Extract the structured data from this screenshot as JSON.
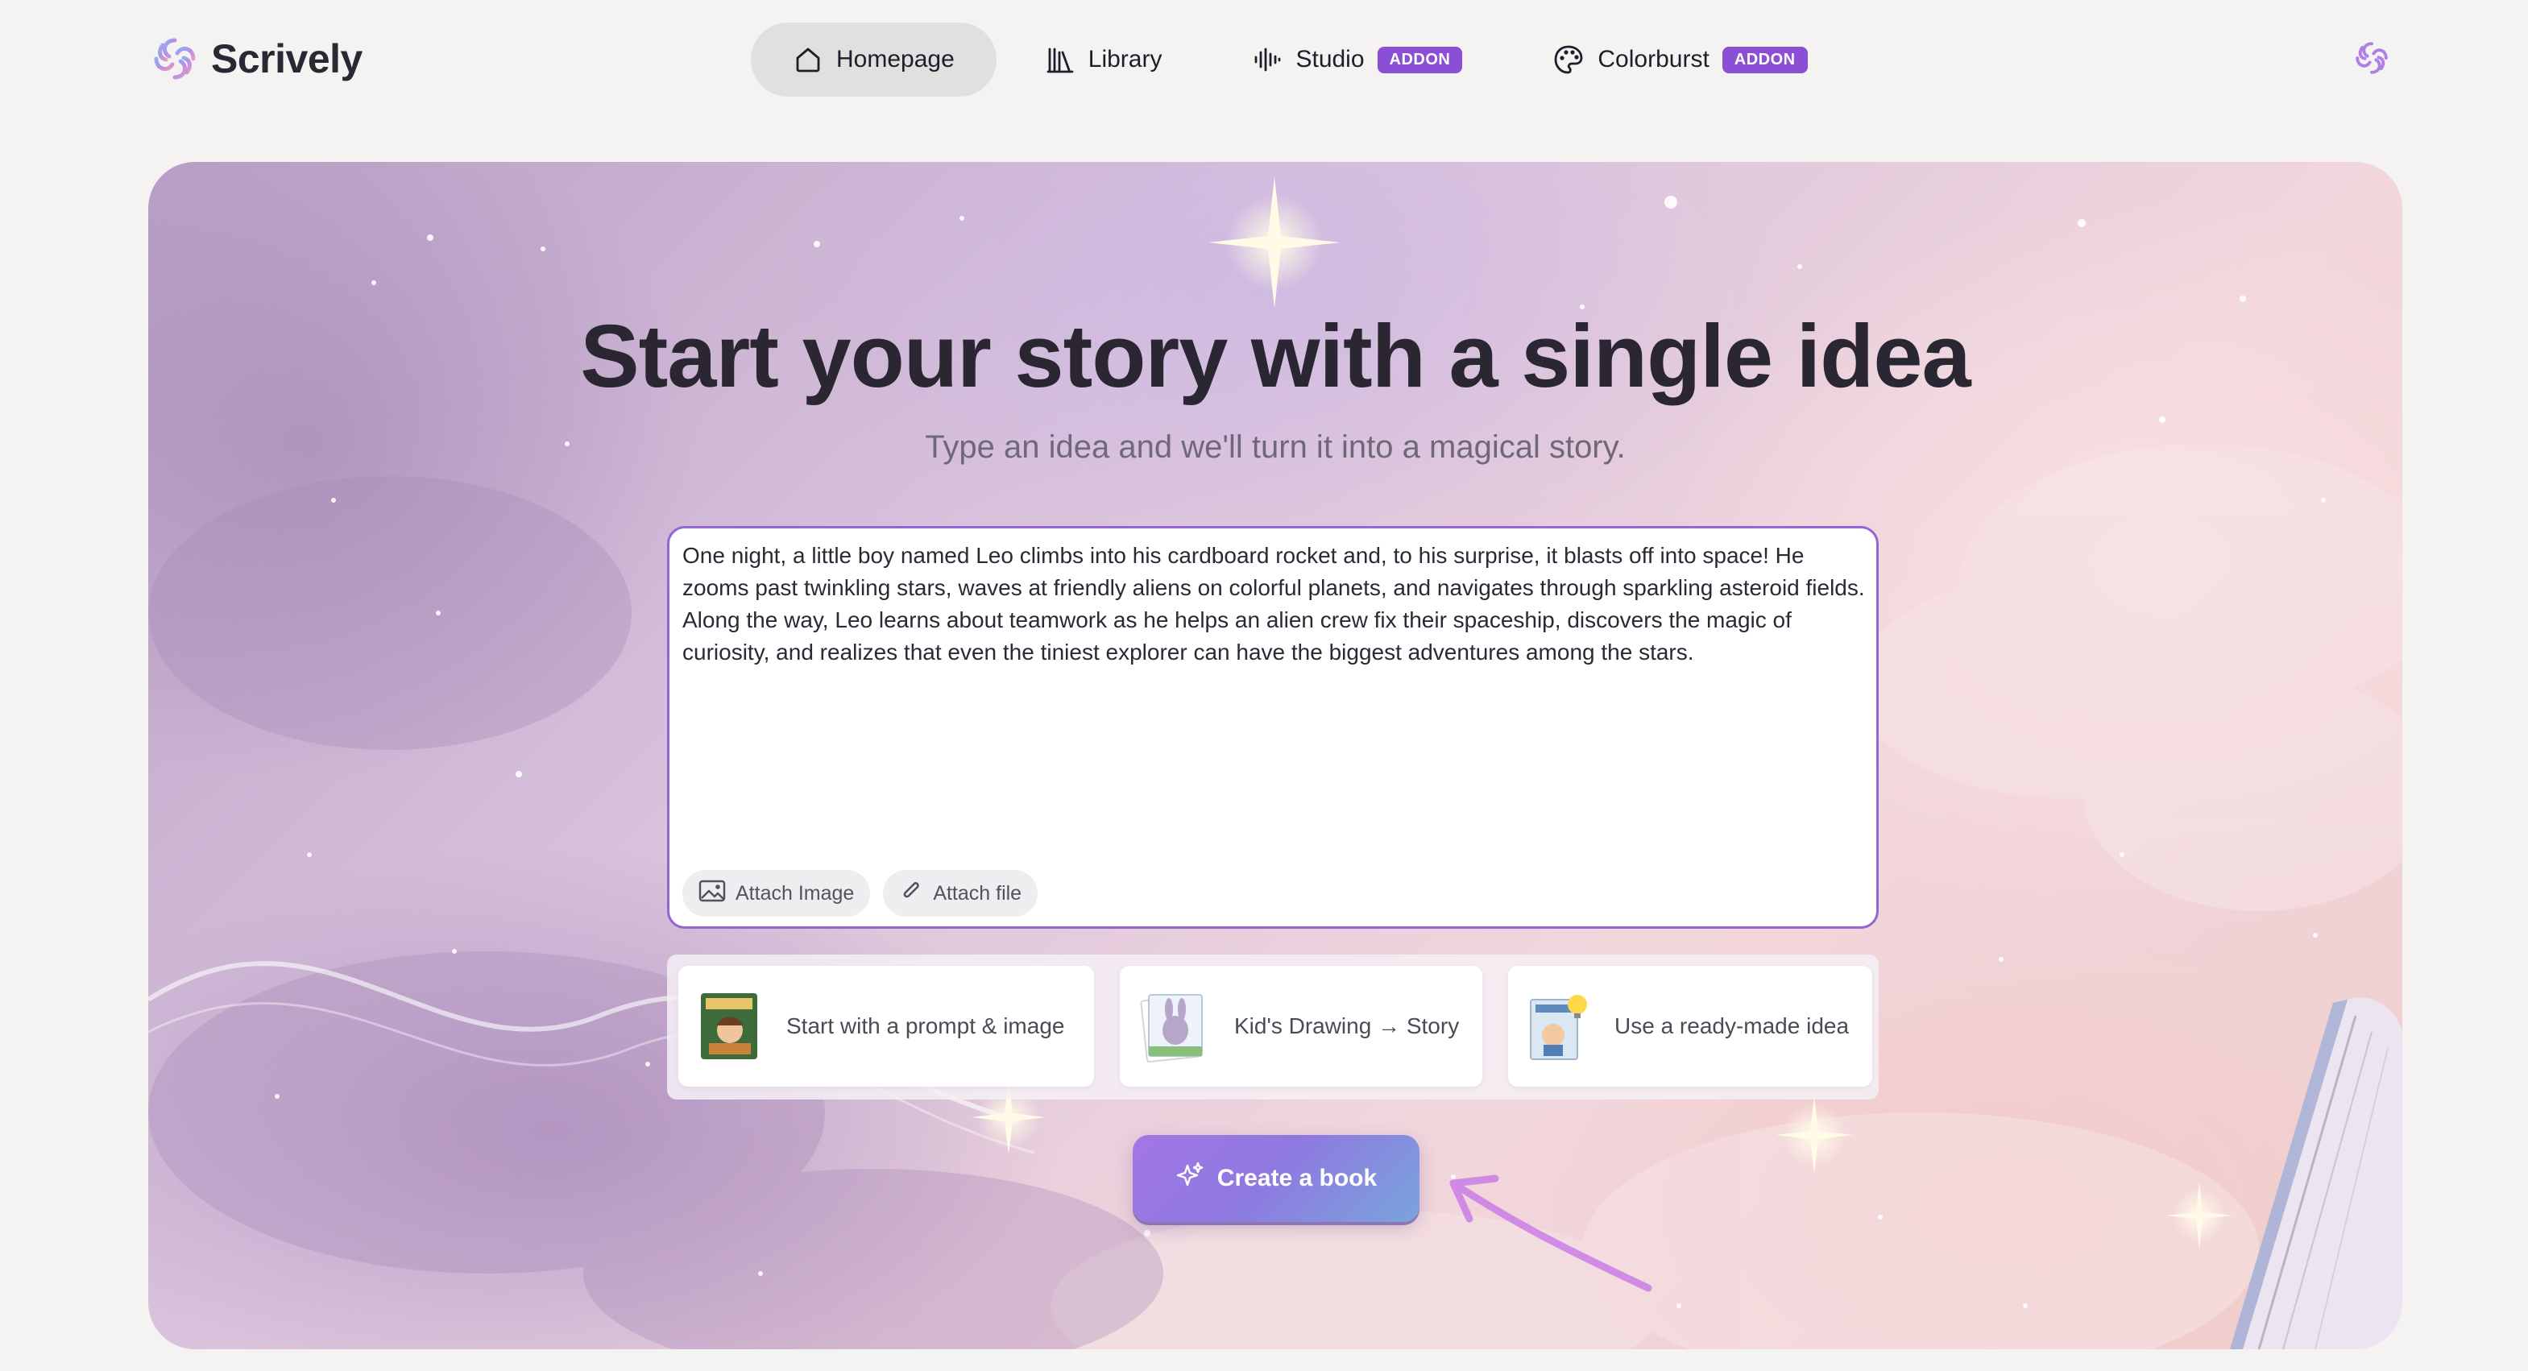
{
  "app": {
    "name": "Scrively"
  },
  "nav": {
    "items": [
      {
        "label": "Homepage",
        "icon": "home-icon",
        "active": true
      },
      {
        "label": "Library",
        "icon": "library-icon"
      },
      {
        "label": "Studio",
        "icon": "waveform-icon",
        "badge": "ADDON"
      },
      {
        "label": "Colorburst",
        "icon": "palette-icon",
        "badge": "ADDON"
      }
    ]
  },
  "hero": {
    "title": "Start your story with a single idea",
    "subtitle": "Type an idea and we'll turn it into a magical story."
  },
  "prompt": {
    "value": "One night, a little boy named Leo climbs into his cardboard rocket and, to his surprise, it blasts off into space! He zooms past twinkling stars, waves at friendly aliens on colorful planets, and navigates through sparkling asteroid fields. Along the way, Leo learns about teamwork as he helps an alien crew fix their spaceship, discovers the magic of curiosity, and realizes that even the tiniest explorer can have the biggest adventures among the stars.",
    "attach_image": "Attach Image",
    "attach_file": "Attach file"
  },
  "ideas": [
    {
      "label": "Start with a prompt & image"
    },
    {
      "label": "Kid's Drawing → Story"
    },
    {
      "label": "Use a ready-made idea"
    }
  ],
  "cta": {
    "label": "Create a book"
  },
  "colors": {
    "accent": "#8b4fd6",
    "editor_border": "#9466d4",
    "active_nav_bg": "#e2e0de",
    "cta_start": "#a377e6",
    "cta_end": "#7aa4dc",
    "arrow": "#c97ee6"
  }
}
